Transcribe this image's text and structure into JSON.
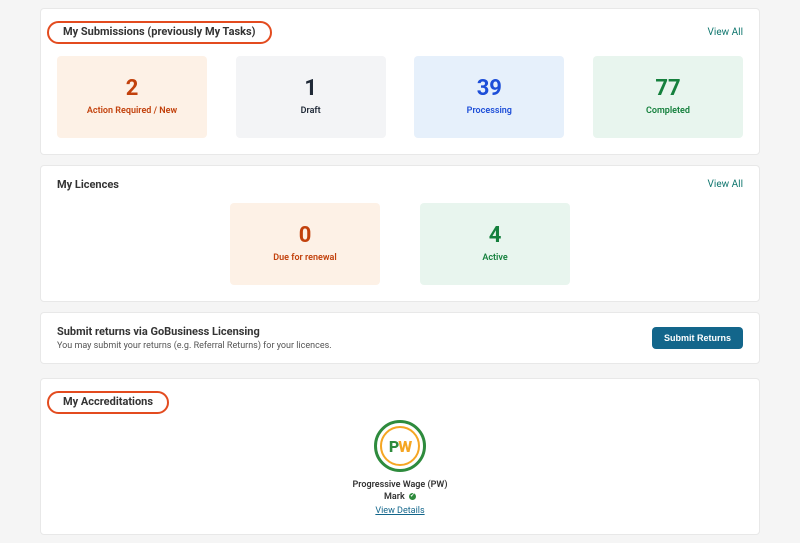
{
  "submissions": {
    "title": "My Submissions (previously My Tasks)",
    "view_all": "View All",
    "tiles": [
      {
        "count": "2",
        "label": "Action Required / New"
      },
      {
        "count": "1",
        "label": "Draft"
      },
      {
        "count": "39",
        "label": "Processing"
      },
      {
        "count": "77",
        "label": "Completed"
      }
    ]
  },
  "licences": {
    "title": "My Licences",
    "view_all": "View All",
    "tiles": [
      {
        "count": "0",
        "label": "Due for renewal"
      },
      {
        "count": "4",
        "label": "Active"
      }
    ]
  },
  "returns": {
    "title": "Submit returns via GoBusiness Licensing",
    "subtitle": "You may submit your returns (e.g. Referral Returns) for your licences.",
    "button": "Submit Returns"
  },
  "accreditations": {
    "title": "My Accreditations",
    "badge_text_p": "P",
    "badge_text_w": "W",
    "name_line1": "Progressive Wage (PW)",
    "name_line2": "Mark",
    "verify_icon": "verified",
    "view_details": "View Details"
  }
}
